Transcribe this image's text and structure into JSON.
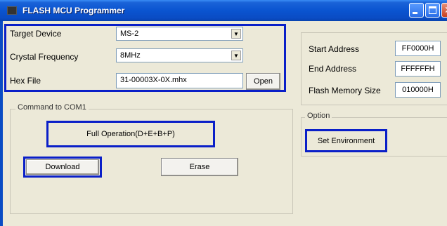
{
  "window": {
    "title": "FLASH MCU Programmer"
  },
  "device": {
    "target_label": "Target Device",
    "target_value": "MS-2",
    "crystal_label": "Crystal Frequency",
    "crystal_value": "8MHz",
    "hex_label": "Hex File",
    "hex_value": "31-00003X-0X.mhx",
    "open_label": "Open"
  },
  "address": {
    "start_label": "Start Address",
    "start_value": "FF0000H",
    "end_label": "End Address",
    "end_value": "FFFFFFH",
    "size_label": "Flash Memory Size",
    "size_value": "010000H"
  },
  "command": {
    "group_title": "Command to COM1",
    "full_label": "Full Operation(D+E+B+P)",
    "download_label": "Download",
    "erase_label": "Erase"
  },
  "option": {
    "group_title": "Option",
    "set_env_label": "Set Environment"
  },
  "colors": {
    "highlight": "#0a1fc8",
    "titlebar": "#0a54d0",
    "face": "#ece9d8"
  }
}
